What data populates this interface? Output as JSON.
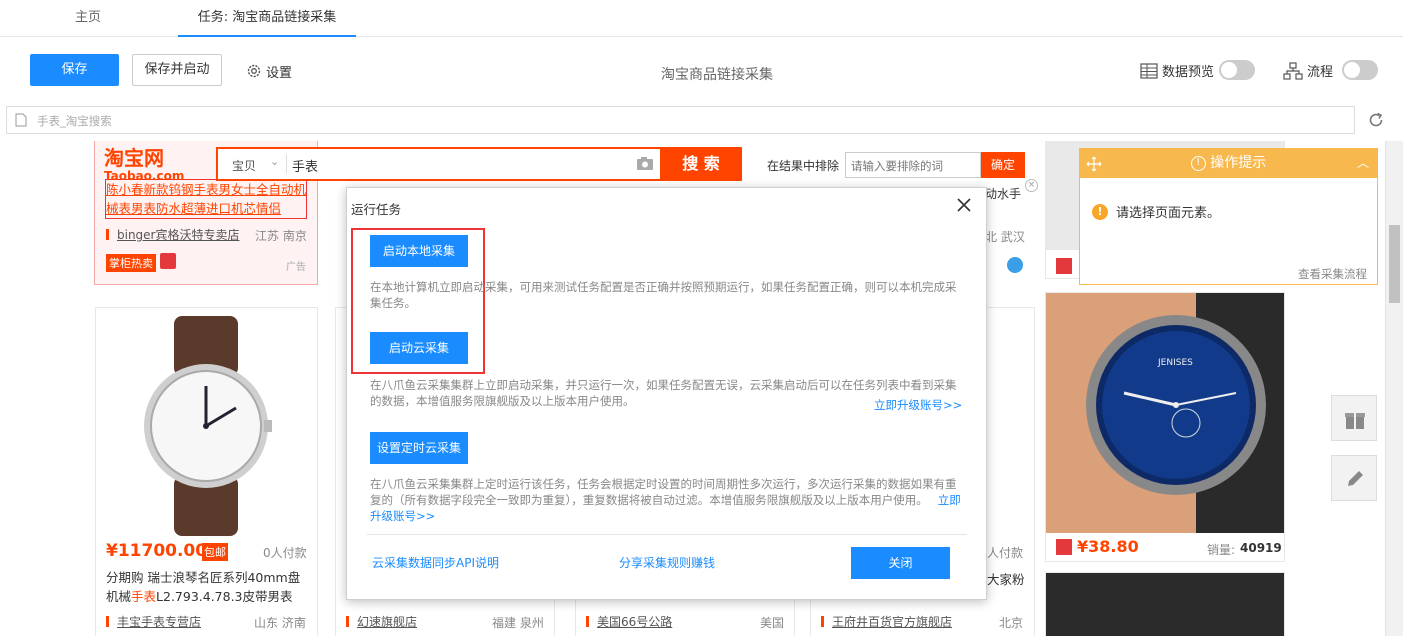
{
  "tabs": [
    {
      "label": "主页",
      "active": false
    },
    {
      "label": "任务: 淘宝商品链接采集",
      "active": true
    }
  ],
  "toolbar": {
    "save": "保存",
    "save_and_start": "保存并启动",
    "settings": "设置",
    "task_title": "淘宝商品链接采集",
    "data_preview": "数据预览",
    "flow": "流程"
  },
  "urlbar": {
    "value": "手表_淘宝搜索"
  },
  "taobao": {
    "logo_cn": "淘宝网",
    "logo_en": "Taobao.com",
    "search_scope": "宝贝",
    "search_query": "手表",
    "search_button": "搜 索",
    "exclude_label": "在结果中排除",
    "exclude_placeholder": "请输入要排除的词",
    "exclude_confirm": "确定"
  },
  "ad_card": {
    "title": "陈小春新款钨钢手表男女士全自动机械表男表防水超薄进口机芯情侣",
    "shop": "binger宾格沃特专卖店",
    "location": "江苏 南京",
    "badge": "掌柜热卖",
    "ad_label": "广告"
  },
  "partial_top": {
    "text1": "动水手",
    "text2": "北 武汉"
  },
  "products": [
    {
      "price": "¥11700.00",
      "tag": "包邮",
      "paid": "0人付款",
      "title_pre": "分期购 瑞士浪琴名匠系列40mm盘机械",
      "title_hl": "手表",
      "title_post": "L2.793.4.78.3皮带男表",
      "shop": "丰宝手表专营店",
      "location": "山东 济南"
    },
    {
      "shop": "幻速旗舰店",
      "location": "福建 泉州"
    },
    {
      "shop": "美国66号公路",
      "location": "美国"
    },
    {
      "paid": "人付款",
      "title_frag": "大家粉",
      "shop": "王府井百货官方旗舰店",
      "location": "北京"
    }
  ],
  "right_product": {
    "price": "¥38.80",
    "sales_label": "销量:",
    "sales_value": "40919",
    "watch_brand": "JENISES"
  },
  "tip": {
    "title": "操作提示",
    "message": "请选择页面元素。",
    "footer_link": "查看采集流程"
  },
  "dialog": {
    "title": "运行任务",
    "local_button": "启动本地采集",
    "local_desc": "在本地计算机立即启动采集，可用来测试任务配置是否正确并按照预期运行，如果任务配置正确，则可以本机完成采集任务。",
    "cloud_button": "启动云采集",
    "cloud_desc": "在八爪鱼云采集集群上立即启动采集，并只运行一次，如果任务配置无误，云采集启动后可以在任务列表中看到采集的数据，本增值服务限旗舰版及以上版本用户使用。",
    "upgrade_link": "立即升级账号>>",
    "schedule_button": "设置定时云采集",
    "schedule_desc": "在八爪鱼云采集集群上定时运行该任务，任务会根据定时设置的时间周期性多次运行，多次运行采集的数据如果有重复的（所有数据字段完全一致即为重复），重复数据将被自动过滤。本增值服务限旗舰版及以上版本用户使用。",
    "api_link": "云采集数据同步API说明",
    "share_link": "分享采集规则赚钱",
    "close_button": "关闭"
  },
  "colors": {
    "accent": "#1a8cff",
    "taobao_orange": "#f40",
    "tip_orange": "#f7b84e",
    "highlight_red": "#e33"
  }
}
